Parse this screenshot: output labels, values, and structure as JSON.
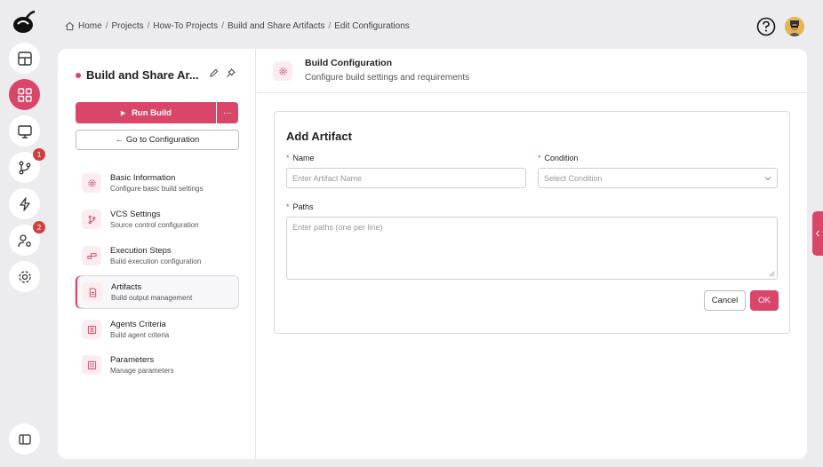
{
  "breadcrumb": [
    "Home",
    "Projects",
    "How-To Projects",
    "Build and Share Artifacts",
    "Edit Configurations"
  ],
  "rail": {
    "items": [
      "dashboard",
      "projects",
      "monitor",
      "vcs",
      "events",
      "users",
      "settings"
    ],
    "vcs_badge": "1",
    "users_badge": "2"
  },
  "sidebar": {
    "title": "Build and Share Ar...",
    "run_label": "Run Build",
    "more_label": "···",
    "goto_label": "← Go to Configuration",
    "items": [
      {
        "label": "Basic Information",
        "sub": "Configure basic build settings"
      },
      {
        "label": "VCS Settings",
        "sub": "Source control configuration"
      },
      {
        "label": "Execution Steps",
        "sub": "Build execution configuration"
      },
      {
        "label": "Artifacts",
        "sub": "Build output management"
      },
      {
        "label": "Agents Criteria",
        "sub": "Build agent criteria"
      },
      {
        "label": "Parameters",
        "sub": "Manage parameters"
      }
    ]
  },
  "header": {
    "title": "Build Configuration",
    "subtitle": "Configure build settings and requirements"
  },
  "form": {
    "title": "Add Artifact",
    "name_label": "Name",
    "name_placeholder": "Enter Artifact Name",
    "condition_label": "Condition",
    "condition_placeholder": "Select Condition",
    "paths_label": "Paths",
    "paths_placeholder": "Enter paths (one per line)",
    "required_mark": "*",
    "cancel_label": "Cancel",
    "ok_label": "OK"
  },
  "colors": {
    "accent": "#d9466a",
    "badge": "#cf3f3f"
  }
}
